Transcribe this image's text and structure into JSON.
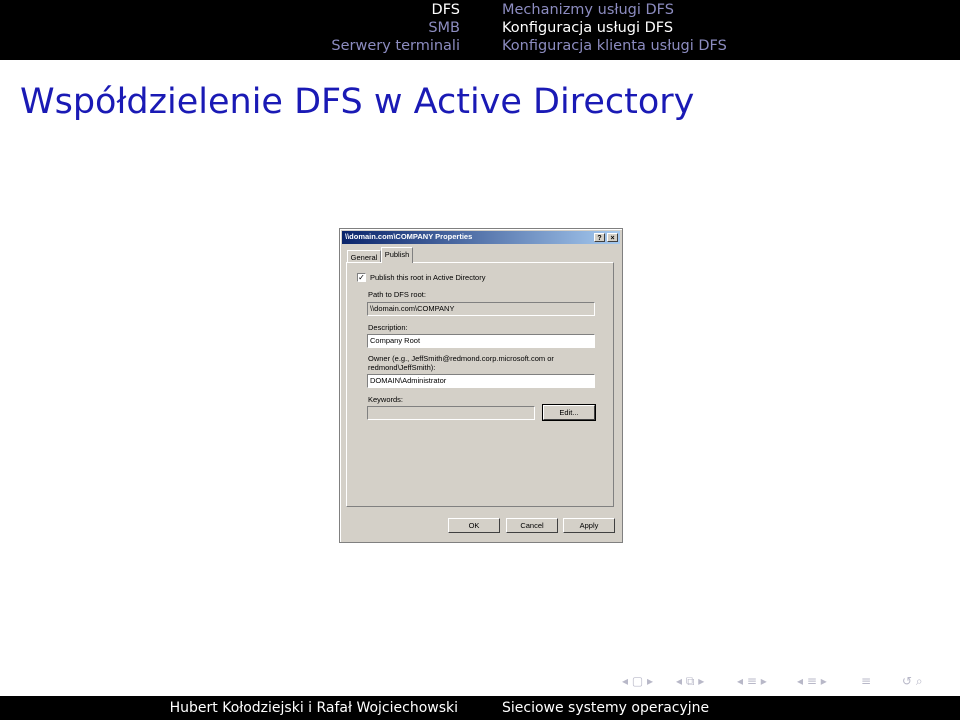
{
  "header": {
    "left": [
      "DFS",
      "SMB",
      "Serwery terminali"
    ],
    "right": [
      "Mechanizmy usługi DFS",
      "Konfiguracja usługi DFS",
      "Konfiguracja klienta usługi DFS"
    ]
  },
  "slide": {
    "title": "Współdzielenie DFS w Active Directory"
  },
  "dialog": {
    "title": "\\\\domain.com\\COMPANY Properties",
    "help_btn": "?",
    "close_btn": "×",
    "tabs": [
      "General",
      "Publish"
    ],
    "publish_checkbox_label": "Publish this root in Active Directory",
    "publish_checked": true,
    "path_label": "Path to DFS root:",
    "path_value": "\\\\domain.com\\COMPANY",
    "description_label": "Description:",
    "description_value": "Company Root",
    "owner_label_1": "Owner (e.g., JeffSmith@redmond.corp.microsoft.com or",
    "owner_label_2": "redmond\\JeffSmith):",
    "owner_value": "DOMAIN\\Administrator",
    "keywords_label": "Keywords:",
    "keywords_value": "",
    "edit_button": "Edit...",
    "ok_button": "OK",
    "cancel_button": "Cancel",
    "apply_button": "Apply"
  },
  "footer": {
    "authors": "Hubert Kołodziejski i Rafał Wojciechowski",
    "course": "Sieciowe systemy operacyjne"
  }
}
